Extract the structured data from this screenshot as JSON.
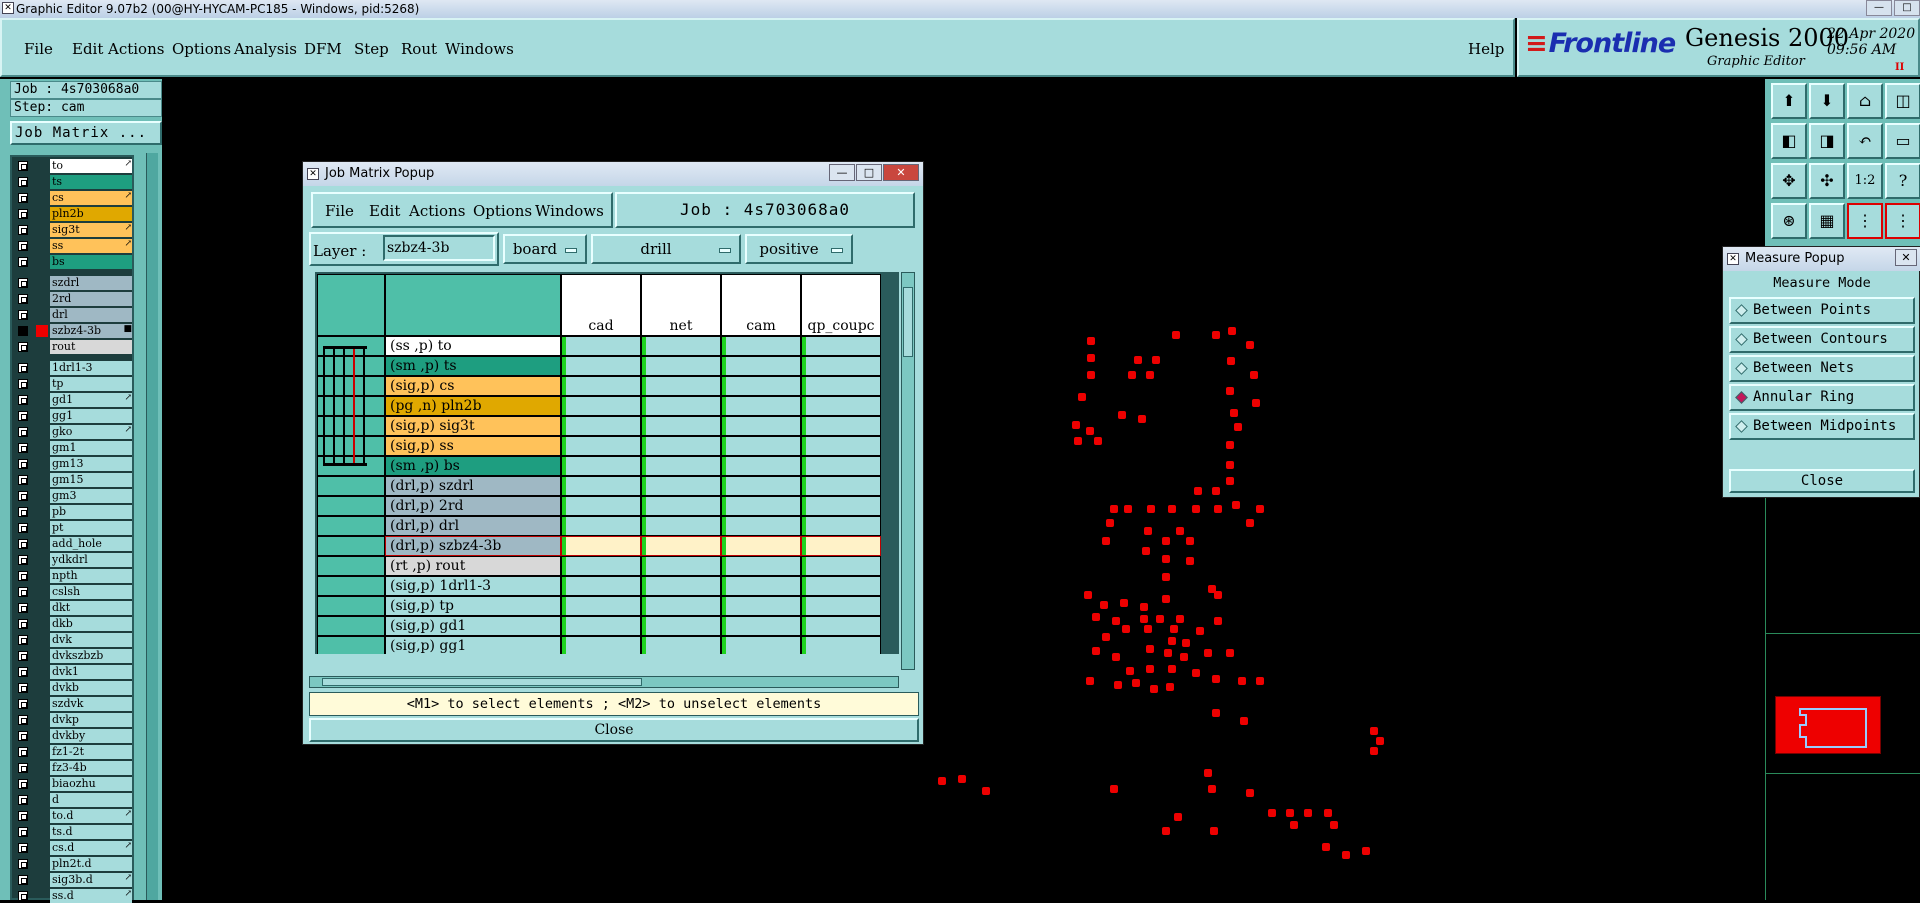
{
  "window": {
    "title": "Graphic Editor 9.07b2 (00@HY-HYCAM-PC185 - Windows, pid:5268)"
  },
  "menu": {
    "items": [
      "File",
      "Edit",
      "Actions",
      "Options",
      "Analysis",
      "DFM",
      "Step",
      "Rout",
      "Windows"
    ],
    "help": "Help"
  },
  "brand": {
    "logo": "Frontline",
    "product": "Genesis 2000",
    "subtitle": "Graphic Editor",
    "date": "22 Apr 2020",
    "time": "09:56 AM",
    "indicator": "II"
  },
  "left": {
    "job": "Job : 4s703068a0",
    "step": "Step: cam",
    "job_matrix_button": "Job Matrix ..."
  },
  "layers": [
    {
      "name": "to",
      "color": "#ffffff",
      "mark": "↗"
    },
    {
      "name": "ts",
      "color": "#1e9e80",
      "mark": ""
    },
    {
      "name": "cs",
      "color": "#ffc25a",
      "mark": "↗"
    },
    {
      "name": "pln2b",
      "color": "#e0a800",
      "mark": ""
    },
    {
      "name": "sig3t",
      "color": "#ffc25a",
      "mark": "↗"
    },
    {
      "name": "ss",
      "color": "#ffc25a",
      "mark": "↗"
    },
    {
      "name": "bs",
      "color": "#1e9e80",
      "mark": ""
    },
    {
      "name": "szdrl",
      "color": "#9fb8c4",
      "mark": ""
    },
    {
      "name": "2rd",
      "color": "#9fb8c4",
      "mark": ""
    },
    {
      "name": "drl",
      "color": "#9fb8c4",
      "mark": ""
    },
    {
      "name": "szbz4-3b",
      "color": "#9fb8c4",
      "mark": "■"
    },
    {
      "name": "rout",
      "color": "#d8d8d8",
      "mark": ""
    },
    {
      "name": "1drl1-3",
      "color": "#a6dcdc",
      "mark": ""
    },
    {
      "name": "tp",
      "color": "#a6dcdc",
      "mark": ""
    },
    {
      "name": "gd1",
      "color": "#a6dcdc",
      "mark": "↗"
    },
    {
      "name": "gg1",
      "color": "#a6dcdc",
      "mark": ""
    },
    {
      "name": "gko",
      "color": "#a6dcdc",
      "mark": "↗"
    },
    {
      "name": "gm1",
      "color": "#a6dcdc",
      "mark": ""
    },
    {
      "name": "gm13",
      "color": "#a6dcdc",
      "mark": ""
    },
    {
      "name": "gm15",
      "color": "#a6dcdc",
      "mark": ""
    },
    {
      "name": "gm3",
      "color": "#a6dcdc",
      "mark": ""
    },
    {
      "name": "pb",
      "color": "#a6dcdc",
      "mark": ""
    },
    {
      "name": "pt",
      "color": "#a6dcdc",
      "mark": ""
    },
    {
      "name": "add_hole",
      "color": "#a6dcdc",
      "mark": ""
    },
    {
      "name": "ydkdrl",
      "color": "#a6dcdc",
      "mark": ""
    },
    {
      "name": "npth",
      "color": "#a6dcdc",
      "mark": ""
    },
    {
      "name": "cslsh",
      "color": "#a6dcdc",
      "mark": ""
    },
    {
      "name": "dkt",
      "color": "#a6dcdc",
      "mark": ""
    },
    {
      "name": "dkb",
      "color": "#a6dcdc",
      "mark": ""
    },
    {
      "name": "dvk",
      "color": "#a6dcdc",
      "mark": ""
    },
    {
      "name": "dvkszbzb",
      "color": "#a6dcdc",
      "mark": ""
    },
    {
      "name": "dvk1",
      "color": "#a6dcdc",
      "mark": ""
    },
    {
      "name": "dvkb",
      "color": "#a6dcdc",
      "mark": ""
    },
    {
      "name": "szdvk",
      "color": "#a6dcdc",
      "mark": ""
    },
    {
      "name": "dvkp",
      "color": "#a6dcdc",
      "mark": ""
    },
    {
      "name": "dvkby",
      "color": "#a6dcdc",
      "mark": ""
    },
    {
      "name": "fz1-2t",
      "color": "#a6dcdc",
      "mark": ""
    },
    {
      "name": "fz3-4b",
      "color": "#a6dcdc",
      "mark": ""
    },
    {
      "name": "biaozhu",
      "color": "#a6dcdc",
      "mark": ""
    },
    {
      "name": "d",
      "color": "#a6dcdc",
      "mark": ""
    },
    {
      "name": "to.d",
      "color": "#a6dcdc",
      "mark": "↗"
    },
    {
      "name": "ts.d",
      "color": "#a6dcdc",
      "mark": ""
    },
    {
      "name": "cs.d",
      "color": "#a6dcdc",
      "mark": "↗"
    },
    {
      "name": "pln2t.d",
      "color": "#a6dcdc",
      "mark": ""
    },
    {
      "name": "sig3b.d",
      "color": "#a6dcdc",
      "mark": "↗"
    },
    {
      "name": "ss.d",
      "color": "#a6dcdc",
      "mark": "↗"
    }
  ],
  "job_matrix": {
    "title": "Job Matrix Popup",
    "menu": [
      "File",
      "Edit",
      "Actions",
      "Options",
      "Windows"
    ],
    "job": "Job : 4s703068a0",
    "layer_label": "Layer :",
    "layer_value": "szbz4-3b",
    "context": "board",
    "type": "drill",
    "polarity": "positive",
    "steps": [
      "cad",
      "net",
      "cam",
      "qp_coupc"
    ],
    "rows": [
      {
        "label": "(ss ,p) to",
        "color": "#ffffff"
      },
      {
        "label": "(sm ,p) ts",
        "color": "#1e9e80"
      },
      {
        "label": "(sig,p) cs",
        "color": "#ffc25a"
      },
      {
        "label": "(pg ,n) pln2b",
        "color": "#e0a800"
      },
      {
        "label": "(sig,p) sig3t",
        "color": "#ffc25a"
      },
      {
        "label": "(sig,p) ss",
        "color": "#ffc25a"
      },
      {
        "label": "(sm ,p) bs",
        "color": "#1e9e80"
      },
      {
        "label": "(drl,p) szdrl",
        "color": "#9fb8c4"
      },
      {
        "label": "(drl,p) 2rd",
        "color": "#9fb8c4"
      },
      {
        "label": "(drl,p) drl",
        "color": "#9fb8c4"
      },
      {
        "label": "(drl,p) szbz4-3b",
        "color": "#9fb8c4"
      },
      {
        "label": "(rt ,p) rout",
        "color": "#d8d8d8"
      },
      {
        "label": "(sig,p) 1drl1-3",
        "color": "#a6dcdc"
      },
      {
        "label": "(sig,p) tp",
        "color": "#a6dcdc"
      },
      {
        "label": "(sig,p) gd1",
        "color": "#a6dcdc"
      },
      {
        "label": "(sig,p) gg1",
        "color": "#a6dcdc"
      }
    ],
    "selected_row": 10,
    "hint": "<M1> to select elements ; <M2> to unselect elements",
    "close": "Close"
  },
  "measure": {
    "title": "Measure Popup",
    "mode_label": "Measure Mode",
    "options": [
      "Between Points",
      "Between Contours",
      "Between Nets",
      "Annular Ring",
      "Between Midpoints"
    ],
    "selected": 3,
    "close": "Close"
  },
  "toolbar": {
    "icons": [
      "open-job-icon",
      "save-icon",
      "home-icon",
      "split-view-icon",
      "zoom-left-icon",
      "zoom-right-icon",
      "undo-zoom-icon",
      "panel-icon",
      "fit-icon",
      "zoom-extent-icon",
      "scale-1-2-icon",
      "help-icon",
      "measure-icon",
      "grid-icon",
      "layer-compare-icon",
      "layer-compare-2-icon"
    ],
    "glyphs": [
      "⬆",
      "⬇",
      "⌂",
      "◫",
      "◧",
      "◨",
      "↶",
      "▭",
      "✥",
      "✣",
      "1:2",
      "?",
      "⊛",
      "▦",
      "⋮",
      "⋮"
    ]
  },
  "colors": {
    "panel": "#a6dcdc",
    "border": "#2f6b6b",
    "pad": "#ee0000",
    "canvas": "#000000"
  }
}
